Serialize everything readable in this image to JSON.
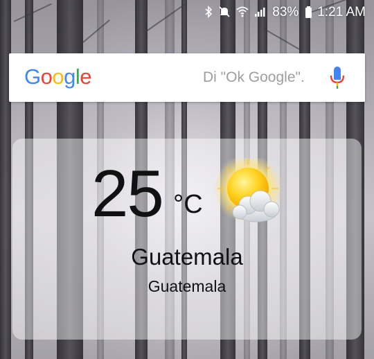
{
  "status_bar": {
    "battery": "83%",
    "time": "1:21 AM",
    "icons": [
      "bluetooth-icon",
      "mute-icon",
      "wifi-icon",
      "signal-icon",
      "battery-icon"
    ]
  },
  "search": {
    "logo": [
      "G",
      "o",
      "o",
      "g",
      "l",
      "e"
    ],
    "logo_colors": [
      "#4285F4",
      "#EA4335",
      "#FBBC05",
      "#4285F4",
      "#34A853",
      "#EA4335"
    ],
    "hint": "Di \"Ok Google\".",
    "mic_icon": "microphone-icon"
  },
  "weather": {
    "temperature": "25",
    "unit": "°C",
    "condition_icon": "partly-sunny-icon",
    "city": "Guatemala",
    "country": "Guatemala"
  }
}
